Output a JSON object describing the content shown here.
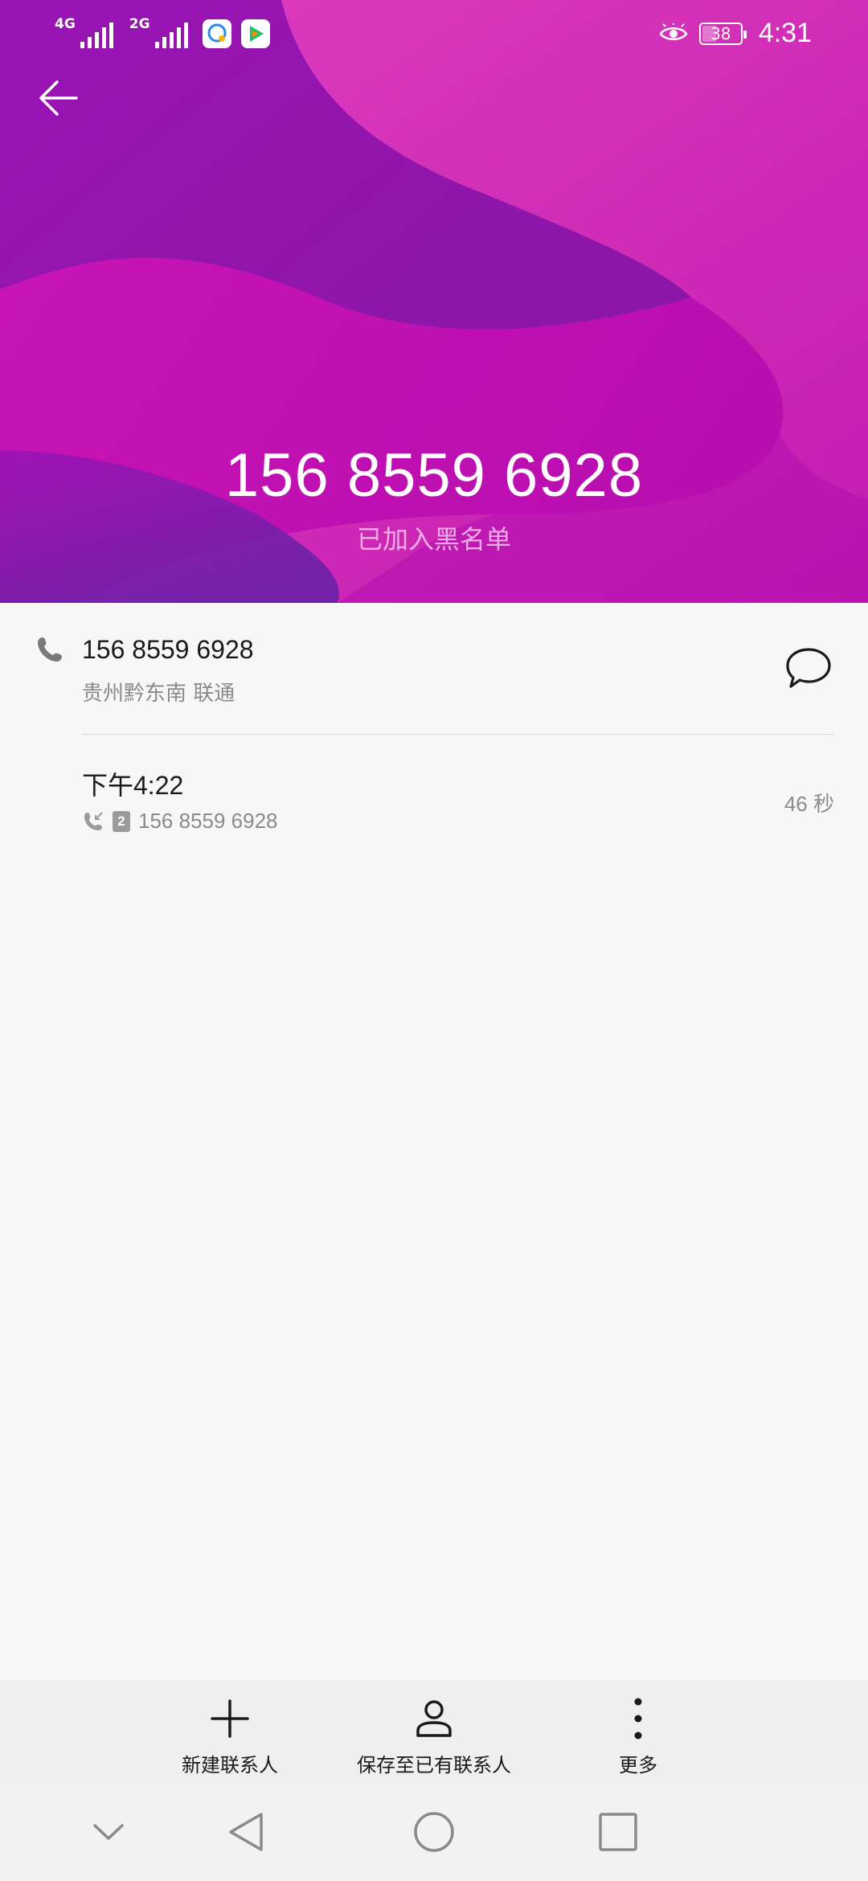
{
  "status_bar": {
    "network_1": "4G",
    "network_2": "2G",
    "battery": "38",
    "battery_level": 0.38,
    "time": "4:31",
    "icons": [
      "signal-icon",
      "signal-icon",
      "chat-app-icon",
      "video-app-icon",
      "eye-comfort-icon",
      "battery-icon"
    ]
  },
  "header": {
    "number": "156 8559 6928",
    "subtitle": "已加入黑名单",
    "back_icon": "arrow-left-icon",
    "gradient_colors": [
      "#8e1cb6",
      "#c010b2",
      "#e040c0"
    ]
  },
  "contact": {
    "number": "156 8559 6928",
    "location": "贵州黔东南 联通",
    "phone_icon": "phone-icon",
    "message_icon": "message-bubble-icon"
  },
  "call_log": [
    {
      "time": "下午4:22",
      "sim": "2",
      "number": "156 8559 6928",
      "duration": "46 秒",
      "type_icon": "incoming-call-icon"
    }
  ],
  "actions": {
    "new_contact": "新建联系人",
    "save_existing": "保存至已有联系人",
    "more": "更多"
  },
  "nav": {
    "icons": [
      "chevron-down-icon",
      "back-triangle-icon",
      "home-circle-icon",
      "recents-square-icon"
    ]
  }
}
